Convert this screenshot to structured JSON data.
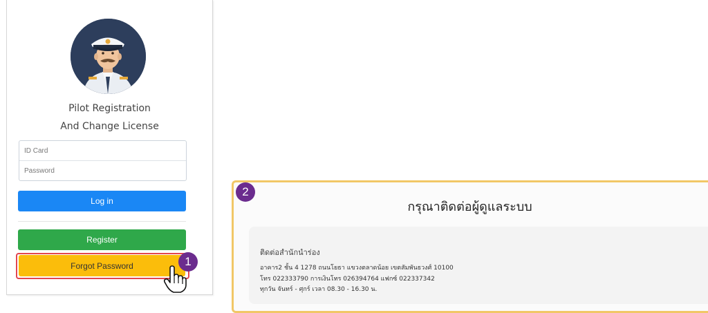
{
  "login": {
    "title_line1": "Pilot Registration",
    "title_line2": "And Change License",
    "id_card_placeholder": "ID Card",
    "password_placeholder": "Password",
    "login_label": "Log in",
    "register_label": "Register",
    "forgot_label": "Forgot Password"
  },
  "steps": {
    "step1": "1",
    "step2": "2"
  },
  "contact": {
    "title": "กรุณาติดต่อผู้ดูแลระบบ",
    "heading": "ติดต่อสำนักนำร่อง",
    "address": "อาคาร2 ชั้น 4 1278 ถนนโยธา แขวงตลาดน้อย เขตสัมพันธวงศ์ 10100",
    "phone": "โทร 022333790 การเงินโทร 026394764 แฟกซ์ 022337342",
    "hours": "ทุกวัน จันทร์ - ศุกร์ เวลา 08.30 - 16.30 น."
  },
  "colors": {
    "login_button": "#1a87f5",
    "register_button": "#2fa84a",
    "forgot_button": "#fbbd0b",
    "highlight_outline": "#e2454f",
    "step_badge": "#6b2c8e",
    "contact_border": "#f1c766"
  },
  "icons": {
    "avatar": "pilot-avatar-illustration",
    "cursor": "hand-pointer-icon"
  }
}
